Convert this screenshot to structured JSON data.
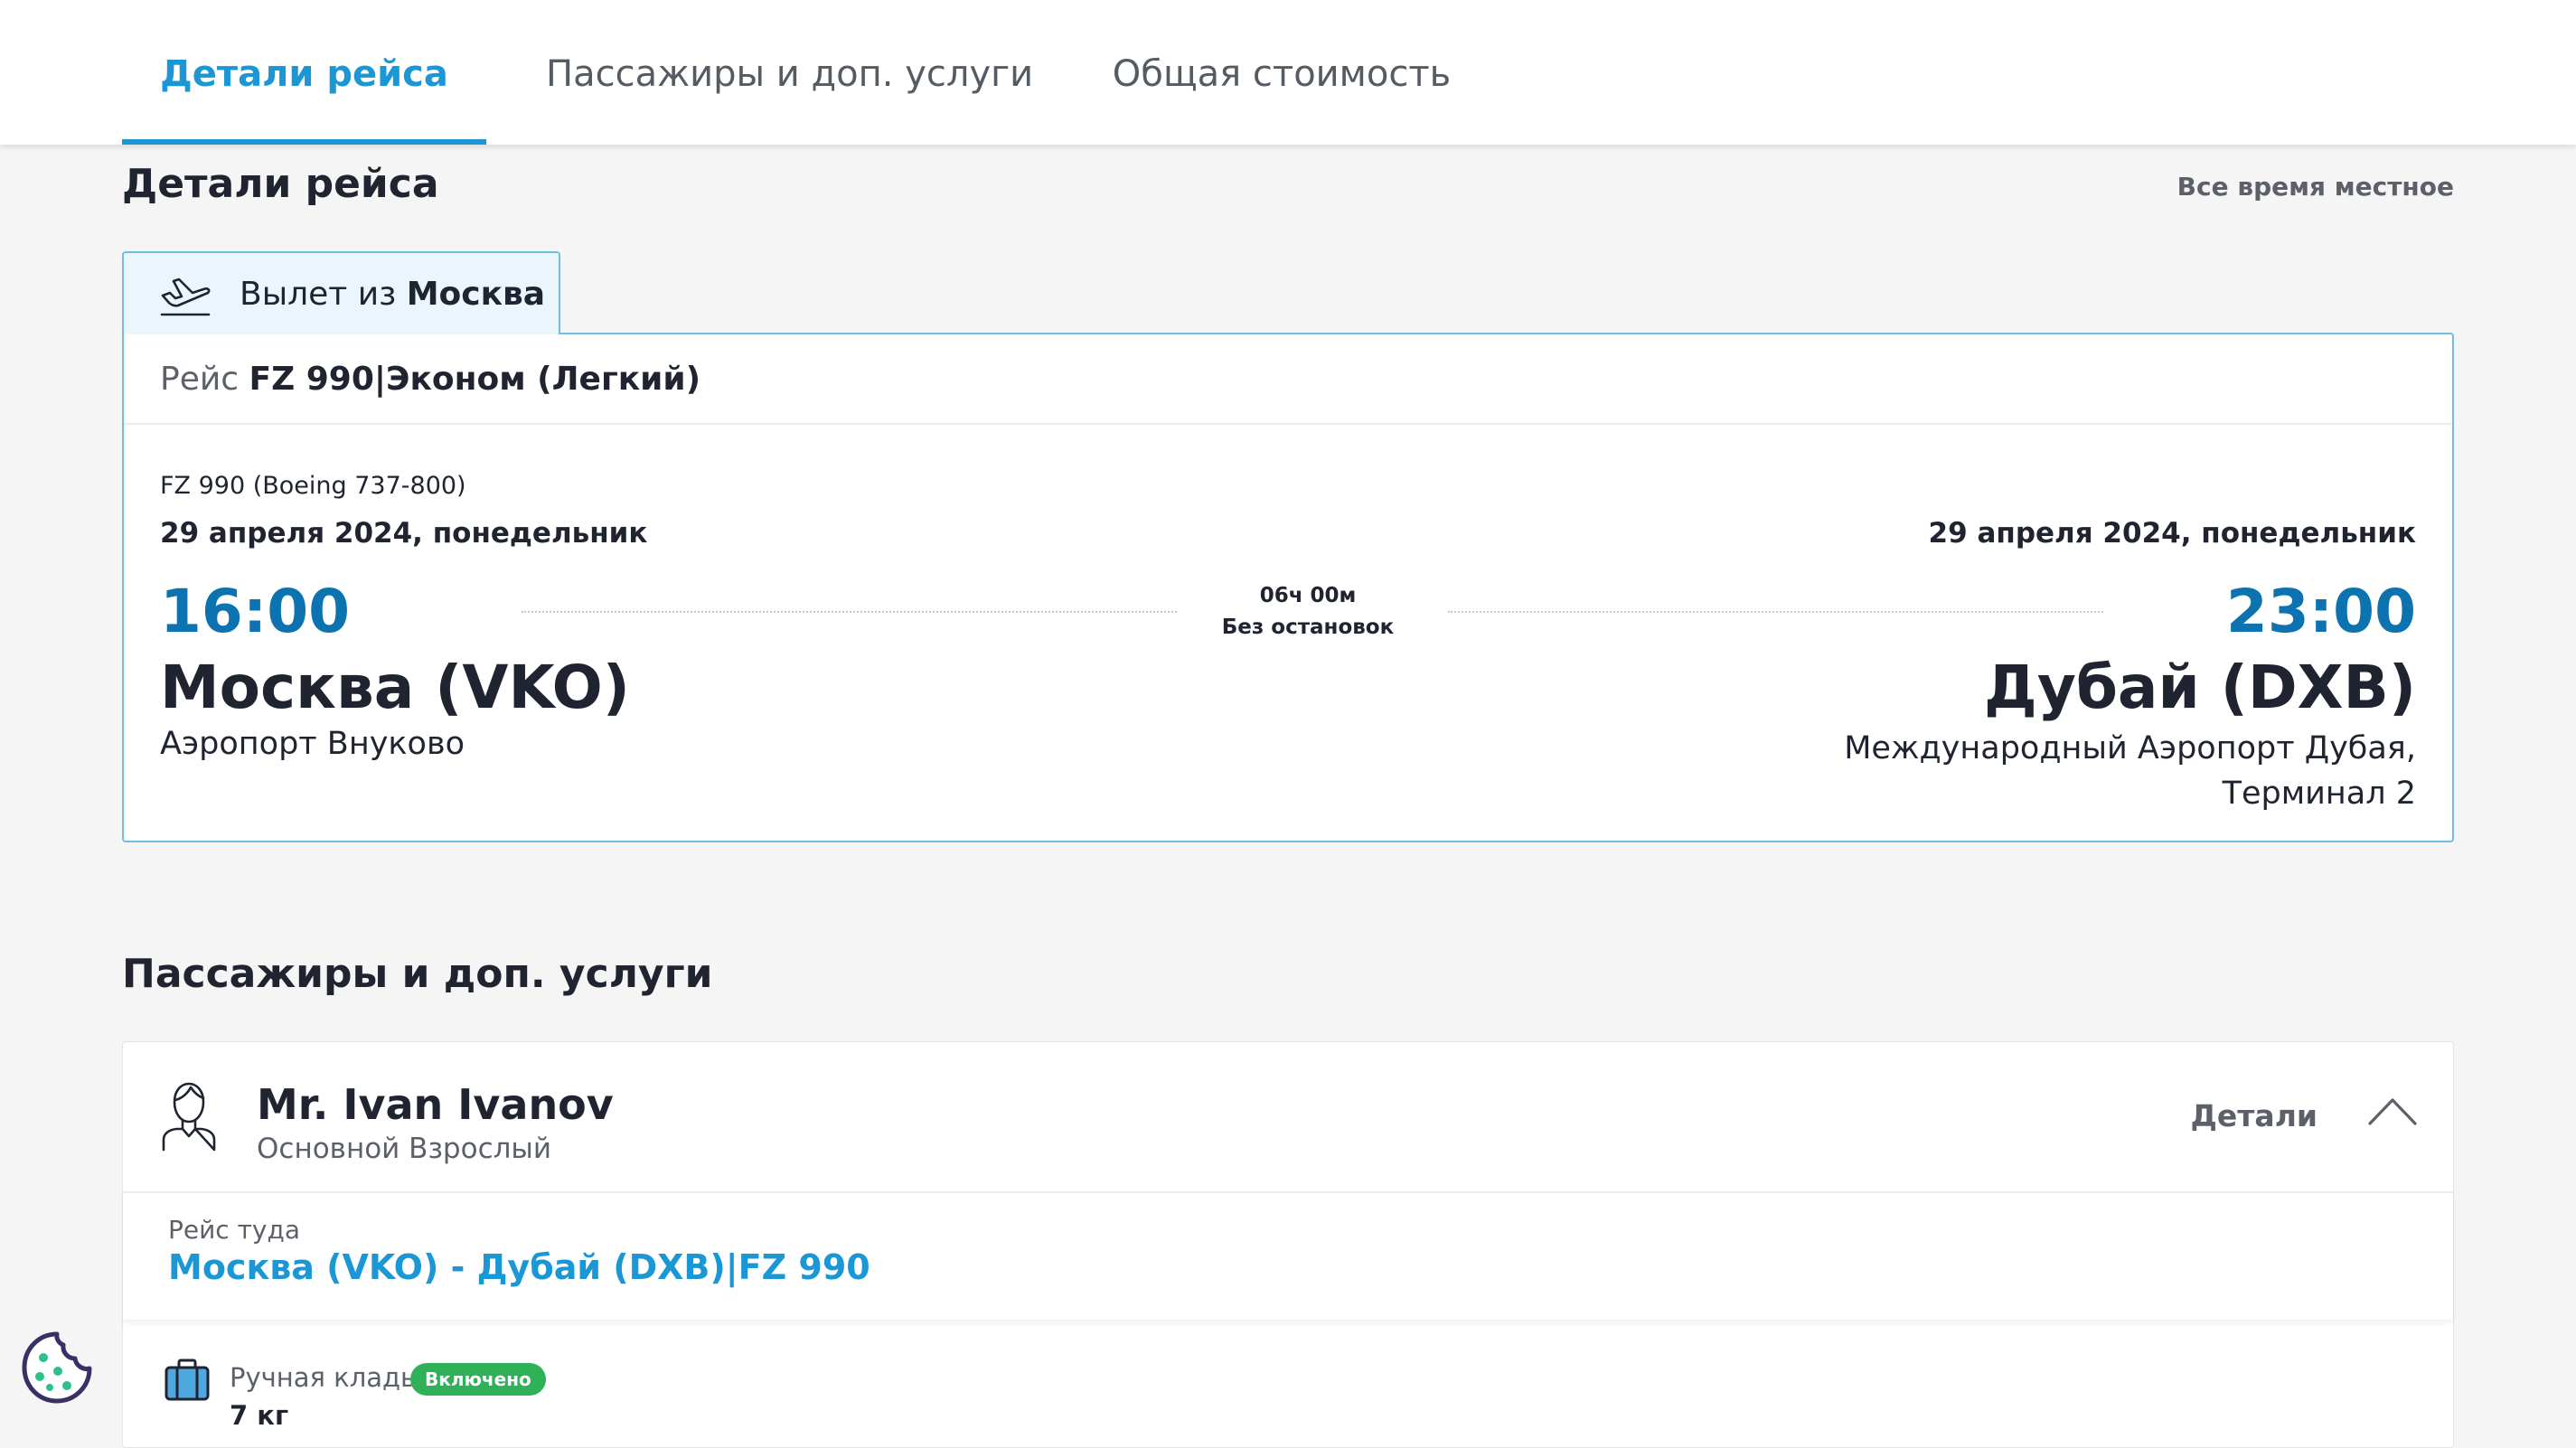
{
  "tabs": [
    {
      "label": "Детали рейса",
      "active": true
    },
    {
      "label": "Пассажиры и доп. услуги",
      "active": false
    },
    {
      "label": "Общая стоимость",
      "active": false
    }
  ],
  "flight_details": {
    "title": "Детали рейса",
    "local_time_note": "Все время местное",
    "departure_tab": {
      "prefix": "Вылет из",
      "city": "Москва",
      "icon": "plane-takeoff-icon"
    },
    "card": {
      "header_prefix": "Рейс",
      "header_flight": "FZ 990|Эконом (Легкий)",
      "aircraft": "FZ 990 (Boeing 737-800)",
      "departure": {
        "date": "29 апреля 2024, понедельник",
        "time": "16:00",
        "city": "Москва (VKO)",
        "airport": "Аэропорт Внуково"
      },
      "arrival": {
        "date": "29 апреля 2024, понедельник",
        "time": "23:00",
        "city": "Дубай (DXB)",
        "airport_line1": "Международный Аэропорт Дубая,",
        "airport_line2": "Терминал 2"
      },
      "duration": "06ч 00м",
      "stops": "Без остановок"
    }
  },
  "passengers": {
    "title": "Пассажиры и доп. услуги",
    "passenger": {
      "name": "Mr. Ivan Ivanov",
      "type": "Основной Взрослый",
      "details_label": "Детали",
      "icon": "person-icon"
    },
    "route": {
      "label": "Рейс туда",
      "value": "Москва (VKO) - Дубай (DXB)|FZ 990"
    },
    "baggage": {
      "label": "Ручная кладь",
      "badge": "Включено",
      "weight": "7 кг",
      "icon": "suitcase-icon"
    }
  },
  "colors": {
    "accent": "#1b97d6",
    "time_blue": "#0d72b0",
    "badge_green": "#2fb15a",
    "background": "#f5f5f5"
  }
}
